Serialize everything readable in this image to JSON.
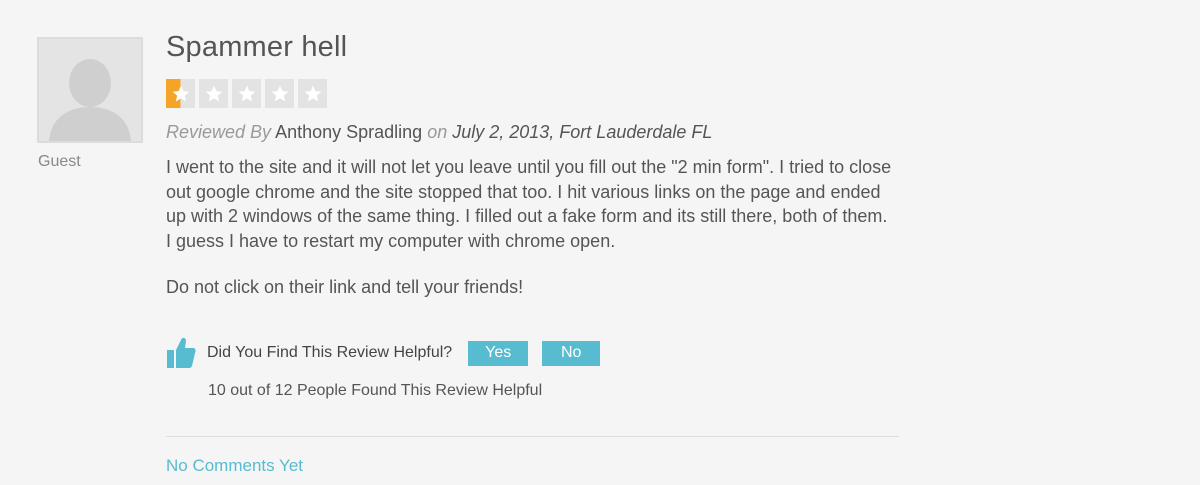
{
  "review": {
    "title": "Spammer hell",
    "rating": 1,
    "rating_max": 5,
    "reviewer_label": "Guest",
    "byline": {
      "prefix": "Reviewed By",
      "author": "Anthony Spradling",
      "on_word": "on",
      "date_location": "July 2, 2013, Fort Lauderdale FL"
    },
    "paragraphs": [
      "I went to the site and it will not let you leave until you fill out the \"2 min form\". I tried to close out google chrome and the site stopped that too. I hit various links on the page and ended up with 2 windows of the same thing. I filled out a fake form and its still there, both of them. I guess I have to restart my computer with chrome open.",
      "Do not click on their link and tell your friends!"
    ],
    "helpful": {
      "question": "Did You Find This Review Helpful?",
      "yes_label": "Yes",
      "no_label": "No",
      "summary": "10 out of 12 People Found This Review Helpful"
    },
    "comments_link": "No Comments Yet"
  },
  "colors": {
    "accent": "#58bcd0",
    "star_filled": "#f4a528",
    "star_empty": "#e3e3e3",
    "background": "#f5f5f5"
  },
  "icons": {
    "avatar": "user-silhouette-icon",
    "helpful": "thumbs-up-icon",
    "rating": "star-icon"
  }
}
